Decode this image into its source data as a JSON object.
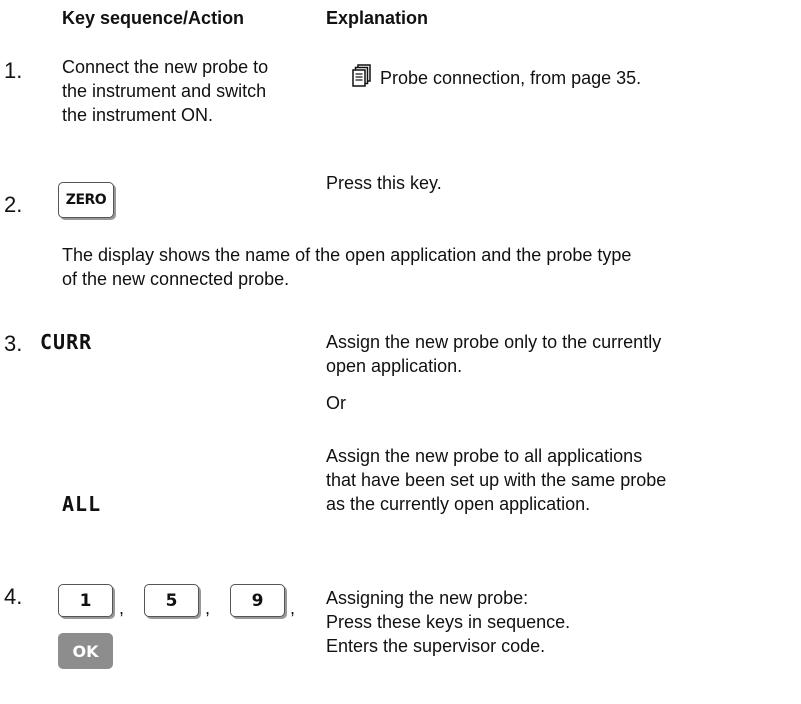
{
  "headers": {
    "key_sequence": "Key sequence/Action",
    "explanation": "Explanation"
  },
  "steps": [
    {
      "number": "1.",
      "action": [
        "Connect the new probe to",
        "the instrument and switch",
        "the instrument ON."
      ],
      "explanation": "Probe connection, from page 35.",
      "icon": "book-reference-icon"
    },
    {
      "number": "2.",
      "key": "ZERO",
      "explanation": "Press this key.",
      "note": [
        "The display shows the name of the open application and the probe type",
        "of the new connected probe."
      ]
    },
    {
      "number": "3.",
      "display_curr": "CURR",
      "explanation_curr": [
        "Assign the new probe only to the currently",
        "open application."
      ],
      "or": "Or",
      "display_all": "ALL",
      "explanation_all": [
        "Assign the new probe to all applications",
        "that have been set up with the same probe",
        "as the currently open application."
      ]
    },
    {
      "number": "4.",
      "keys": [
        "1",
        "5",
        "9"
      ],
      "separator": ",",
      "ok_key": "OK",
      "explanation": [
        "Assigning the new probe:",
        "Press these keys in sequence.",
        "Enters the supervisor code."
      ]
    }
  ]
}
